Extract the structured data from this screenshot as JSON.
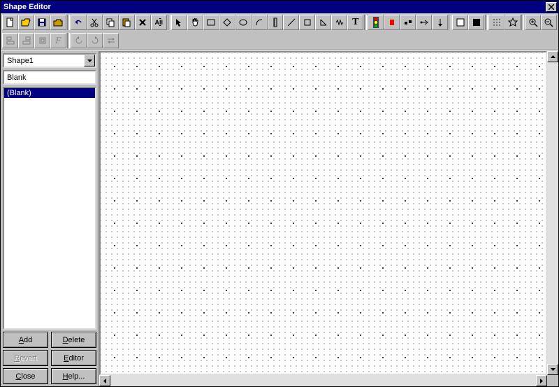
{
  "window": {
    "title": "Shape Editor"
  },
  "toolbars": {
    "row1": [
      "new",
      "open",
      "save",
      "open-yellow",
      "|",
      "undo",
      "cut",
      "copy",
      "paste",
      "delete",
      "select-all",
      "|",
      "pointer",
      "hand",
      "rect",
      "diamond",
      "ellipse",
      "arc",
      "ruler-v",
      "line",
      "square",
      "angle",
      "zigzag",
      "text",
      "|",
      "stoplight",
      "record",
      "handle",
      "flip",
      "down",
      "|",
      "rect-outline",
      "rect-filled",
      "|",
      "grid",
      "target",
      "|",
      "zoom-in",
      "zoom-out"
    ],
    "row2": [
      "align-left",
      "align-right",
      "center",
      "bold",
      "sep",
      "rotate-ccw",
      "rotate-cw",
      "swap"
    ]
  },
  "sidebar": {
    "shape_selector": "Shape1",
    "name_field": "Blank",
    "list_items": [
      "(Blank)"
    ],
    "buttons": {
      "add": "Add",
      "delete": "Delete",
      "revert": "Revert",
      "editor": "Editor",
      "close": "Close",
      "help": "Help..."
    }
  }
}
